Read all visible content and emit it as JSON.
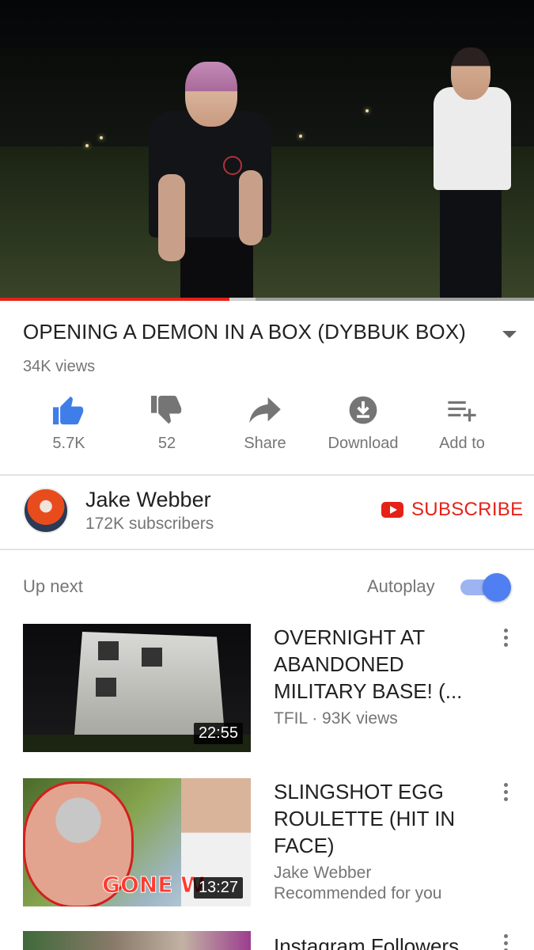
{
  "player": {
    "progress_played": 0.43,
    "progress_buffered_end": 0.478
  },
  "video": {
    "title": "OPENING A DEMON IN A BOX (DYBBUK BOX)",
    "views": "34K views"
  },
  "actions": {
    "like_count": "5.7K",
    "dislike_count": "52",
    "share_label": "Share",
    "download_label": "Download",
    "add_to_label": "Add to"
  },
  "channel": {
    "name": "Jake Webber",
    "subscribers": "172K subscribers",
    "subscribe_label": "SUBSCRIBE"
  },
  "up_next": {
    "heading": "Up next",
    "autoplay_label": "Autoplay",
    "autoplay_on": true
  },
  "videos": [
    {
      "title": "OVERNIGHT AT ABANDONED MILITARY BASE! (...",
      "meta1": "TFIL · 93K views",
      "meta2": "",
      "duration": "22:55"
    },
    {
      "title": "SLINGSHOT EGG ROULETTE (HIT IN FACE)",
      "meta1": "Jake Webber",
      "meta2": "Recommended for you",
      "duration": "13:27",
      "thumb_text": "GONE W"
    },
    {
      "title": "Instagram Followers"
    }
  ],
  "colors": {
    "accent_red": "#e62117",
    "toggle_blue": "#4f7ff0",
    "like_blue": "#3f7ee8",
    "icon_gray": "#757575"
  },
  "icons": {
    "like": "thumb-up-icon",
    "dislike": "thumb-down-icon",
    "share": "share-arrow-icon",
    "download": "download-circle-icon",
    "add_to": "playlist-add-icon",
    "expand": "triangle-down-icon",
    "more": "vertical-dots-icon"
  }
}
